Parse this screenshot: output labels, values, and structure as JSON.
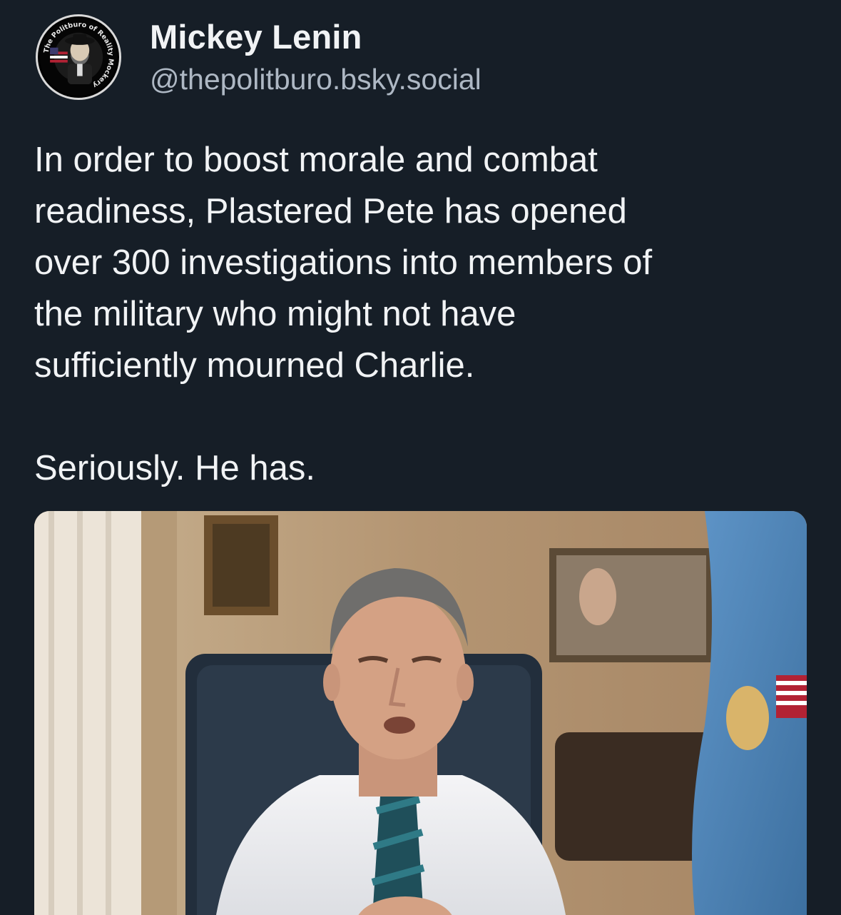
{
  "post": {
    "author": {
      "display_name": "Mickey Lenin",
      "handle": "@thepolitburo.bsky.social",
      "avatar_icon": "politburo-badge-icon",
      "avatar_ring_text": "The Politburo of Reality Mockery"
    },
    "text_paragraphs": [
      "In order to boost morale and combat\nreadiness, Plastered Pete has opened\nover 300 investigations into members of\nthe military who might not have\nsufficiently mourned Charlie.",
      "Seriously. He has."
    ],
    "media": {
      "kind": "image",
      "subject": "man-in-office-photo"
    }
  },
  "colors": {
    "background": "#161e27",
    "text": "#f1f3f5",
    "handle": "#aeb8c4"
  }
}
